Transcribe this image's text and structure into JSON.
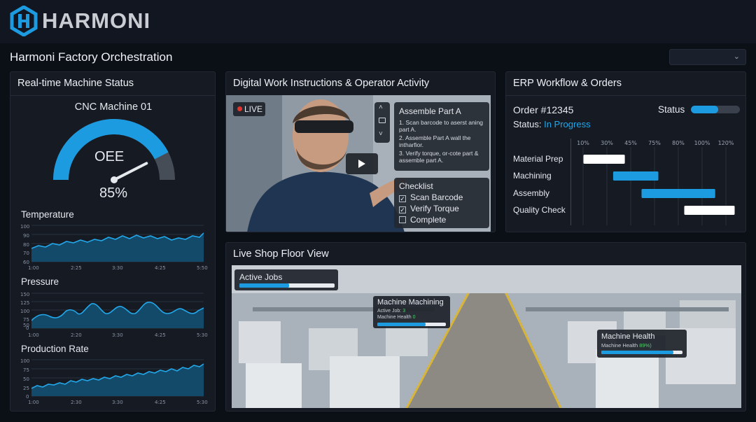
{
  "brand": {
    "name": "HARMONI"
  },
  "page": {
    "title": "Harmoni Factory Orchestration"
  },
  "colors": {
    "accent": "#1d9be0",
    "panel": "#151a23",
    "background": "#0b0f16"
  },
  "machine_status": {
    "title": "Real-time Machine Status",
    "machine_name": "CNC Machine 01",
    "gauge_label": "OEE",
    "gauge_value": "85%",
    "gauge_fraction": 0.85,
    "charts": [
      {
        "title": "Temperature",
        "y_ticks": [
          "100",
          "90",
          "80",
          "70",
          "60"
        ],
        "x_ticks": [
          "1:00",
          "2:25",
          "3:30",
          "4:25",
          "5:50"
        ]
      },
      {
        "title": "Pressure",
        "y_ticks": [
          "150",
          "125",
          "100",
          "75",
          "50",
          "0"
        ],
        "x_ticks": [
          "1:00",
          "2:20",
          "3:30",
          "4:25",
          "5:30"
        ]
      },
      {
        "title": "Production Rate",
        "y_ticks": [
          "100",
          "75",
          "50",
          "25",
          "0"
        ],
        "x_ticks": [
          "1:00",
          "2:30",
          "3:30",
          "4:25",
          "5:30"
        ]
      }
    ]
  },
  "work_instructions": {
    "title": "Digital Work Instructions & Operator Activity",
    "live_label": "LIVE",
    "instruction_title": "Assemble Part A",
    "steps": [
      "1. Scan barcode to aserst aning part A.",
      "2. Assemble Part A wall the intharfior.",
      "3. Verify torque, or-cote part & assemble part A."
    ],
    "checklist_title": "Checklist",
    "checklist": [
      {
        "label": "Scan Barcode",
        "checked": true
      },
      {
        "label": "Verify Torque",
        "checked": true
      },
      {
        "label": "Complete",
        "checked": false
      }
    ]
  },
  "erp": {
    "title": "ERP Workflow & Orders",
    "order_label": "Order #12345",
    "status_label": "Status",
    "status_prefix": "Status:",
    "status_value": "In Progress",
    "status_fraction": 0.55,
    "percent_ticks": [
      "10%",
      "30%",
      "45%",
      "75%",
      "80%",
      "100%",
      "120%"
    ],
    "tasks": [
      {
        "label": "Material Prep",
        "start": 10,
        "end": 42,
        "color": "#ffffff"
      },
      {
        "label": "Machining",
        "start": 33,
        "end": 68,
        "color": "#1d9be0"
      },
      {
        "label": "Assembly",
        "start": 55,
        "end": 112,
        "color": "#1d9be0"
      },
      {
        "label": "Quality Check",
        "start": 88,
        "end": 127,
        "color": "#ffffff"
      }
    ]
  },
  "shop_floor": {
    "title": "Live Shop Floor View",
    "active_jobs_label": "Active Jobs",
    "active_jobs_fraction": 0.52,
    "machine_card": {
      "title": "Machine  Machining",
      "active_job_label": "Active Job:",
      "active_job_value": "3",
      "health_label": "Machine Health",
      "health_value": "0",
      "health_fraction": 0.7
    },
    "health_card": {
      "title": "Machine Health",
      "health_label": "Machine Health",
      "health_value": "89%)",
      "health_fraction": 0.89
    }
  }
}
